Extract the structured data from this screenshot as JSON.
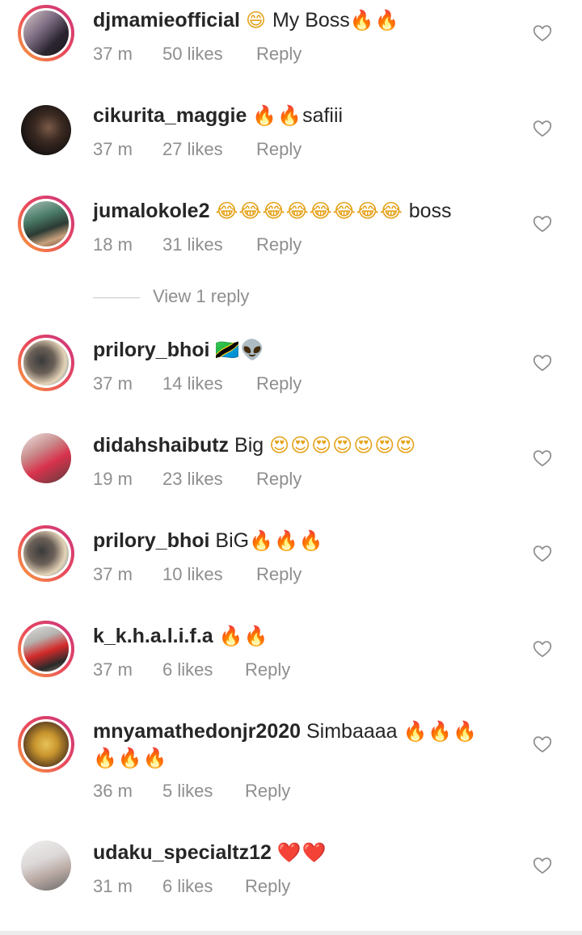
{
  "comments": [
    {
      "username": "djmamieofficial",
      "text": "My Boss",
      "emoji_before": "😄",
      "emoji_after": "🔥🔥",
      "time": "37 m",
      "likes": "50 likes",
      "reply": "Reply"
    },
    {
      "username": "cikurita_maggie",
      "text": "safiii",
      "emoji_before": "🔥🔥",
      "emoji_after": "",
      "time": "37 m",
      "likes": "27 likes",
      "reply": "Reply"
    },
    {
      "username": "jumalokole2",
      "text": "boss",
      "emoji_before": "😂😂😂😂😂😂😂😂",
      "emoji_after": "",
      "time": "18 m",
      "likes": "31 likes",
      "reply": "Reply"
    },
    {
      "username": "prilory_bhoi",
      "text": "",
      "emoji_before": "🇹🇿👽",
      "emoji_after": "",
      "time": "37 m",
      "likes": "14 likes",
      "reply": "Reply"
    },
    {
      "username": "didahshaibutz",
      "text": "Big",
      "emoji_before": "",
      "emoji_after": "😍😍😍😍😍😍😍",
      "time": "19 m",
      "likes": "23 likes",
      "reply": "Reply"
    },
    {
      "username": "prilory_bhoi",
      "text": "BiG",
      "emoji_before": "",
      "emoji_after": "🔥🔥🔥",
      "time": "37 m",
      "likes": "10 likes",
      "reply": "Reply"
    },
    {
      "username": "k_k.h.a.l.i.f.a",
      "text": "",
      "emoji_before": "🔥🔥",
      "emoji_after": "",
      "time": "37 m",
      "likes": "6 likes",
      "reply": "Reply"
    },
    {
      "username": "mnyamathedonjr2020",
      "text": "Simbaaaa",
      "emoji_before": "",
      "emoji_after": "🔥🔥🔥",
      "second_line": "🔥🔥🔥",
      "time": "36 m",
      "likes": "5 likes",
      "reply": "Reply"
    },
    {
      "username": "udaku_specialtz12",
      "text": "",
      "emoji_before": "❤️❤️",
      "emoji_after": "",
      "time": "31 m",
      "likes": "6 likes",
      "reply": "Reply"
    }
  ],
  "view_replies": "View 1 reply",
  "icons": {
    "like": "heart-outline-icon"
  },
  "colors": {
    "text": "#262626",
    "muted": "#8e8e8e",
    "story_ring_start": "#f9a13c",
    "story_ring_end": "#c9357f"
  }
}
